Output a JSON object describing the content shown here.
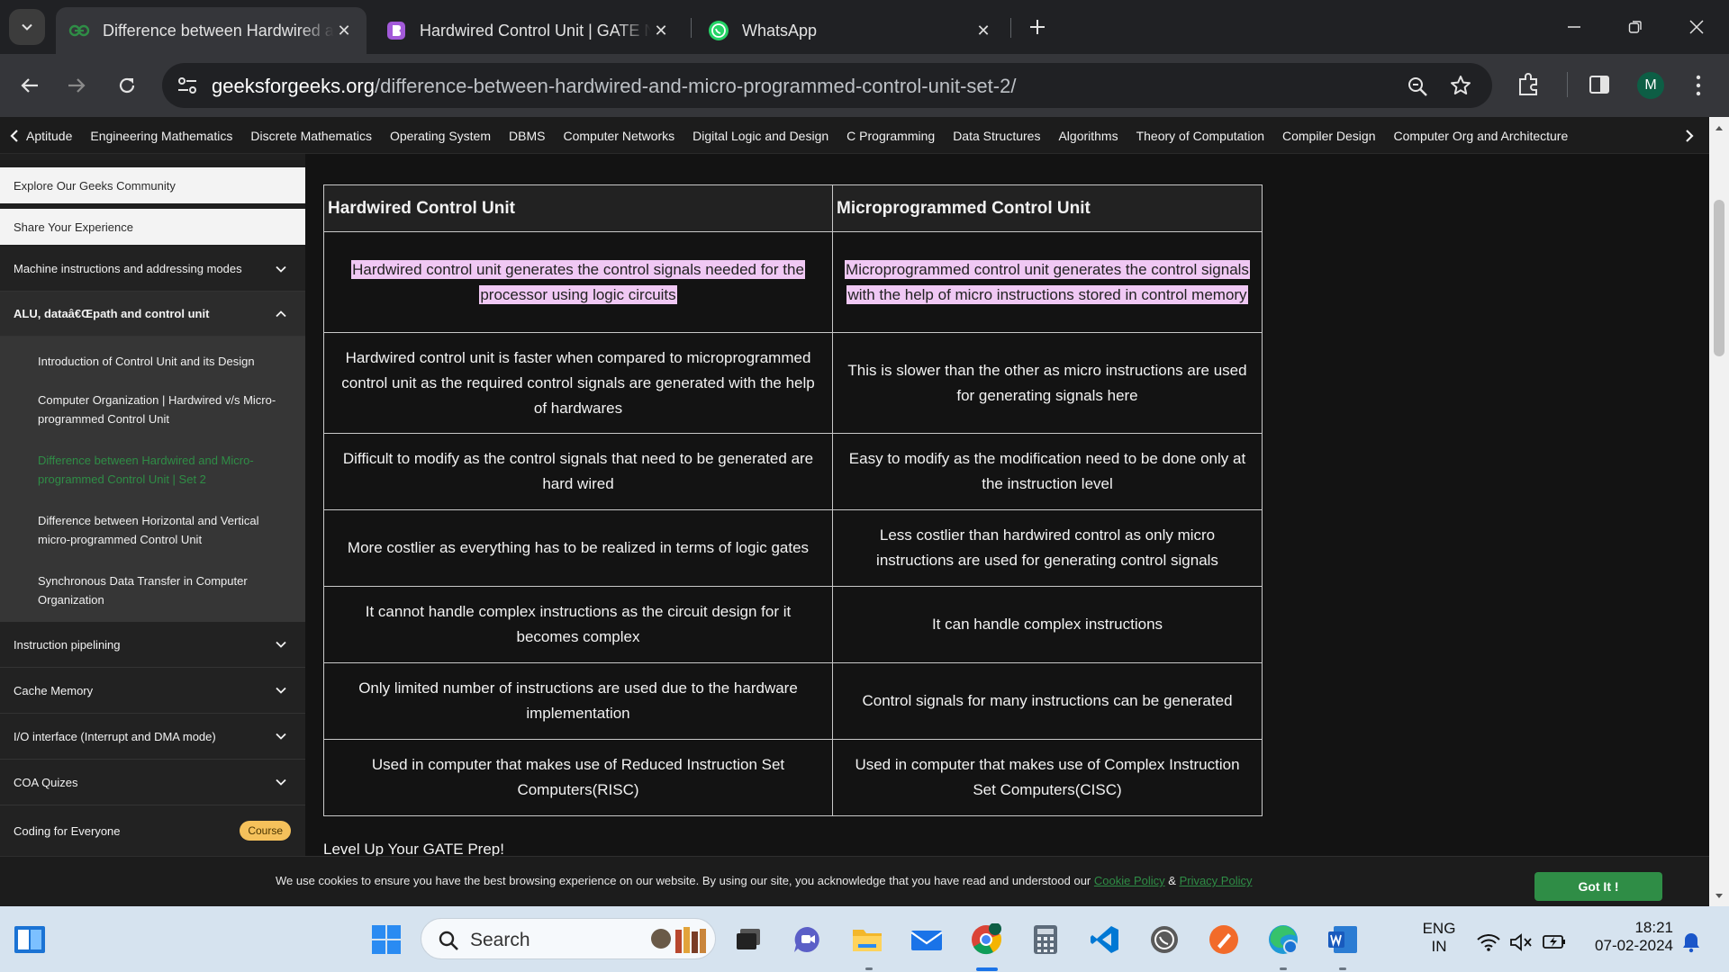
{
  "browser": {
    "tabs": [
      {
        "label": "Difference between Hardwired and Micro-programmed Control Unit",
        "icon": "gfg-icon",
        "active": true
      },
      {
        "label": "Hardwired Control Unit | GATE Notes",
        "icon": "bookmark-app-icon",
        "active": false
      },
      {
        "label": "WhatsApp",
        "icon": "whatsapp-icon",
        "active": false
      }
    ],
    "url_host": "geeksforgeeks.org",
    "url_path": "/difference-between-hardwired-and-micro-programmed-control-unit-set-2/",
    "profile_initial": "M"
  },
  "gfg_nav": {
    "items": [
      "Aptitude",
      "Engineering Mathematics",
      "Discrete Mathematics",
      "Operating System",
      "DBMS",
      "Computer Networks",
      "Digital Logic and Design",
      "C Programming",
      "Data Structures",
      "Algorithms",
      "Theory of Computation",
      "Compiler Design",
      "Computer Org and Architecture"
    ]
  },
  "sidebar": {
    "explore": "Explore Our Geeks Community",
    "share": "Share Your Experience",
    "sections": [
      "Machine instructions and addressing modes",
      "ALU, dataâ€Œpath and control unit",
      "Instruction pipelining",
      "Cache Memory",
      "I/O interface (Interrupt and DMA mode)",
      "COA Quizes",
      "Coding for Everyone"
    ],
    "sub_items": [
      "Introduction of Control Unit and its Design",
      "Computer Organization | Hardwired v/s Micro-programmed Control Unit",
      "Difference between Hardwired and Micro-programmed Control Unit | Set 2",
      "Difference between Horizontal and Vertical micro-programmed Control Unit",
      "Synchronous Data Transfer in Computer Organization"
    ],
    "course_badge": "Course"
  },
  "table": {
    "headers": [
      "Hardwired Control Unit",
      "Microprogrammed Control Unit"
    ],
    "rows": [
      [
        "Hardwired control unit generates the control signals needed for the processor using logic circuits",
        "Microprogrammed control unit generates the control signals with the help of micro instructions stored in control memory"
      ],
      [
        "Hardwired control unit is faster when compared to microprogrammed control unit as the required control signals are generated with the help of hardwares",
        "This is slower than the other as micro instructions are used for generating signals here"
      ],
      [
        "Difficult to modify as the control signals that need to be generated are hard wired",
        "Easy to modify as the modification need to be done only at the instruction level"
      ],
      [
        "More costlier as everything has to be realized in terms of logic gates",
        "Less costlier than hardwired control as only micro instructions are used for generating control signals"
      ],
      [
        "It cannot handle complex instructions as the circuit design for it becomes complex",
        "It can handle complex instructions"
      ],
      [
        "Only limited number of instructions are used due to the hardware implementation",
        "Control signals for many instructions can be generated"
      ],
      [
        "Used in computer that makes use of Reduced Instruction Set Computers(RISC)",
        "Used in computer that makes use of Complex Instruction Set Computers(CISC)"
      ]
    ]
  },
  "main": {
    "level_up": "Level Up Your GATE Prep!"
  },
  "cookie": {
    "text": "We use cookies to ensure you have the best browsing experience on our website. By using our site, you acknowledge that you have read and understood our ",
    "cookie_policy": "Cookie Policy",
    "amp": " & ",
    "privacy_policy": "Privacy Policy",
    "button": "Got It !"
  },
  "taskbar": {
    "search_placeholder": "Search",
    "lang_top": "ENG",
    "lang_bottom": "IN",
    "time": "18:21",
    "date": "07-02-2024"
  },
  "colors": {
    "gfg_green": "#2f8d46",
    "highlight": "#f0c8f4",
    "course_badge": "#f5c15b"
  }
}
